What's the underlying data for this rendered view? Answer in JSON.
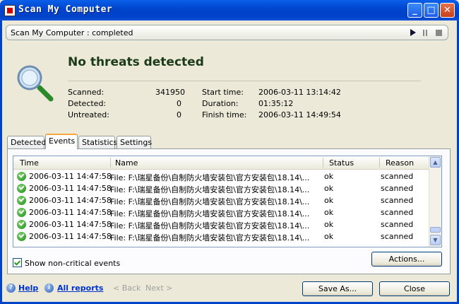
{
  "window": {
    "title": "Scan My Computer"
  },
  "status": {
    "text": "Scan My Computer : completed"
  },
  "summary": {
    "headline": "No threats detected",
    "scanned_label": "Scanned:",
    "scanned_value": "341950",
    "detected_label": "Detected:",
    "detected_value": "0",
    "untreated_label": "Untreated:",
    "untreated_value": "0",
    "start_label": "Start time:",
    "start_value": "2006-03-11 13:14:42",
    "duration_label": "Duration:",
    "duration_value": "01:35:12",
    "finish_label": "Finish time:",
    "finish_value": "2006-03-11 14:49:54"
  },
  "tabs": [
    "Detected",
    "Events",
    "Statistics",
    "Settings"
  ],
  "active_tab": "Events",
  "table": {
    "columns": [
      "Time",
      "Name",
      "Status",
      "Reason"
    ],
    "rows": [
      {
        "time": "2006-03-11 14:47:58",
        "name": "File: F:\\瑞星备份\\自制防火墙安装包\\官方安装包\\18.14\\...",
        "status": "ok",
        "reason": "scanned"
      },
      {
        "time": "2006-03-11 14:47:58",
        "name": "File: F:\\瑞星备份\\自制防火墙安装包\\官方安装包\\18.14\\...",
        "status": "ok",
        "reason": "scanned"
      },
      {
        "time": "2006-03-11 14:47:58",
        "name": "File: F:\\瑞星备份\\自制防火墙安装包\\官方安装包\\18.14\\...",
        "status": "ok",
        "reason": "scanned"
      },
      {
        "time": "2006-03-11 14:47:58",
        "name": "File: F:\\瑞星备份\\自制防火墙安装包\\官方安装包\\18.14\\...",
        "status": "ok",
        "reason": "scanned"
      },
      {
        "time": "2006-03-11 14:47:58",
        "name": "File: F:\\瑞星备份\\自制防火墙安装包\\官方安装包\\18.14\\...",
        "status": "ok",
        "reason": "scanned"
      },
      {
        "time": "2006-03-11 14:47:58",
        "name": "File: F:\\瑞星备份\\自制防火墙安装包\\官方安装包\\18.14\\...",
        "status": "ok",
        "reason": "scanned"
      }
    ]
  },
  "show_noncritical_label": "Show non-critical events",
  "actions_label": "Actions...",
  "footer": {
    "help": "Help",
    "all_reports": "All reports",
    "back": "< Back",
    "next": "Next >",
    "save_as": "Save As...",
    "close": "Close"
  },
  "icons": {
    "app": "shield-icon",
    "magnifier": "magnifier-icon",
    "event_ok": "check-circle-icon",
    "help": "question-icon",
    "info": "info-icon"
  },
  "colors": {
    "titlebar": "#0044CC",
    "accent_tab": "#f8a53b",
    "ok_green": "#1c8a1c"
  }
}
